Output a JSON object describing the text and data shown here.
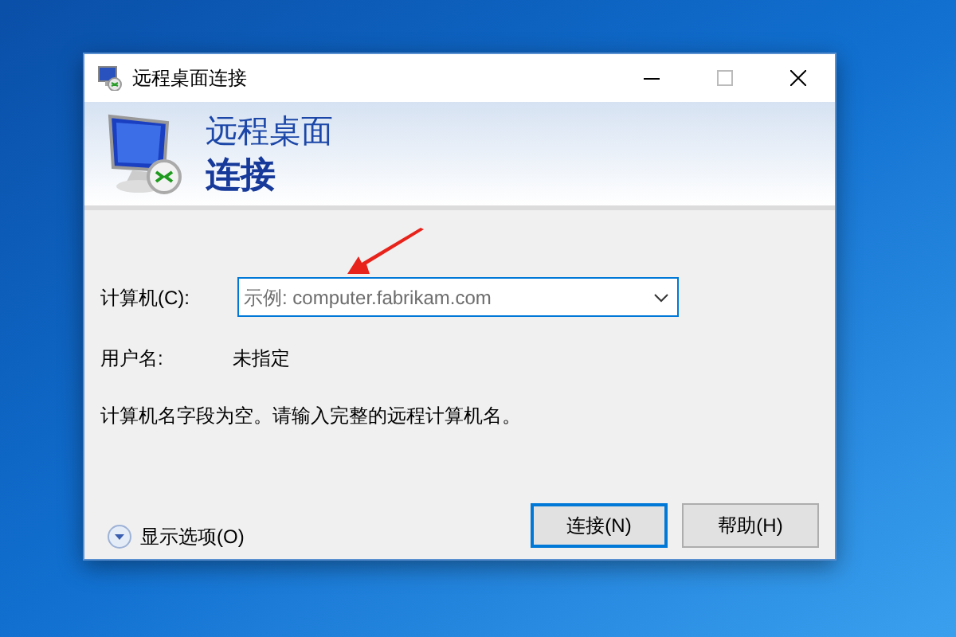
{
  "window": {
    "title": "远程桌面连接"
  },
  "banner": {
    "line_1": "远程桌面",
    "line_2": "连接"
  },
  "computer": {
    "label": "计算机(C):",
    "placeholder": "示例: computer.fabrikam.com"
  },
  "username": {
    "label": "用户名:",
    "value": "未指定"
  },
  "message": "计算机名字段为空。请输入完整的远程计算机名。",
  "options": {
    "label": "显示选项(O)",
    "expanded": false
  },
  "buttons": [
    {
      "label": "连接(N)",
      "default": true
    },
    {
      "label": "帮助(H)",
      "default": false
    }
  ]
}
